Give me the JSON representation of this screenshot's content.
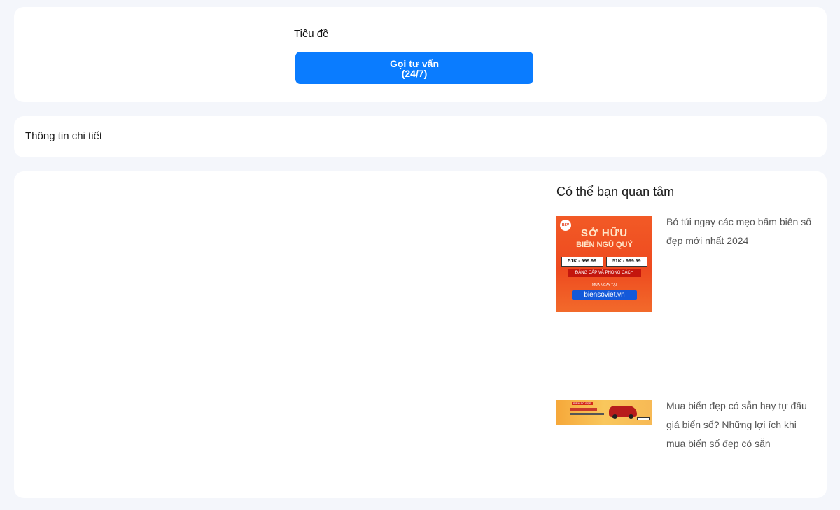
{
  "header_card": {
    "title": "Tiêu đề",
    "cta_line1": "Gọi tư vấn",
    "cta_line2": "(24/7)"
  },
  "info_card": {
    "title": "Thông tin chi tiết"
  },
  "sidebar": {
    "heading": "Có thể bạn quan tâm",
    "items": [
      {
        "title": "Bỏ túi ngay các mẹo bấm biên số đẹp mới nhất 2024",
        "thumb": {
          "line1": "SỞ HỮU",
          "line2": "BIỂN NGŨ QUÝ",
          "plate_left": "51K - 999.99",
          "plate_right": "51K - 999.99",
          "line3": "ĐẲNG CẤP VÀ PHONG CÁCH",
          "line4": "MUA NGAY TẠI",
          "line5": "biensoviet.vn",
          "colors": {
            "bg": "#ee4a1f",
            "accent": "#1459d9"
          }
        }
      },
      {
        "title": "Mua biển đẹp có sẵn hay tự đấu giá biển số? Những lợi ích khi mua biển số đẹp có sẵn",
        "thumb": {
          "tag": "BIỂN SỐ ĐẸP",
          "colors": {
            "bg": "#f9c75c",
            "car": "#b71c1c"
          }
        }
      }
    ]
  },
  "colors": {
    "page_bg": "#f4f6fb",
    "card_bg": "#ffffff",
    "cta_bg": "#0a7cff"
  }
}
